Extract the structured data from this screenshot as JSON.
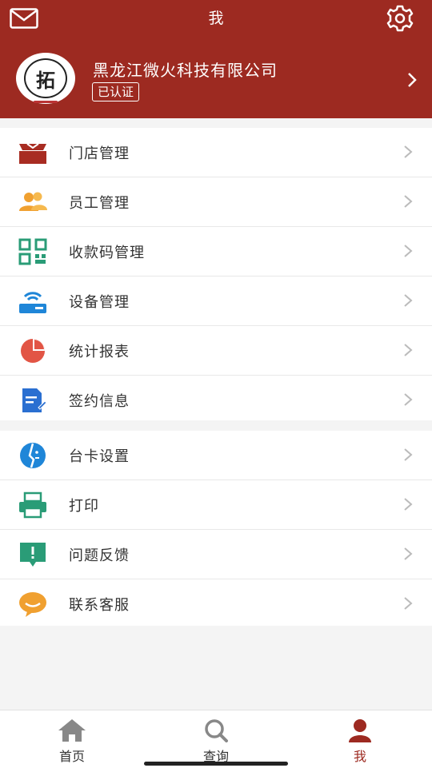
{
  "header": {
    "title": "我",
    "company_name": "黑龙江微火科技有限公司",
    "verified_label": "已认证",
    "avatar_glyph": "拓",
    "bg_color": "#9d2a21"
  },
  "menu_group_1": [
    {
      "label": "门店管理",
      "icon": "store-icon",
      "color": "#a82c22"
    },
    {
      "label": "员工管理",
      "icon": "staff-icon",
      "color": "#f0a030"
    },
    {
      "label": "收款码管理",
      "icon": "qr-code-icon",
      "color": "#2a9c77"
    },
    {
      "label": "设备管理",
      "icon": "router-icon",
      "color": "#1f86d8"
    },
    {
      "label": "统计报表",
      "icon": "pie-chart-icon",
      "color": "#e25545"
    },
    {
      "label": "签约信息",
      "icon": "document-icon",
      "color": "#2a6fd1"
    }
  ],
  "menu_group_2": [
    {
      "label": "台卡设置",
      "icon": "card-stand-icon",
      "color": "#1f86d8"
    },
    {
      "label": "打印",
      "icon": "printer-icon",
      "color": "#2a9c77"
    },
    {
      "label": "问题反馈",
      "icon": "feedback-icon",
      "color": "#2a9c77"
    },
    {
      "label": "联系客服",
      "icon": "chat-bubble-icon",
      "color": "#f0a030"
    }
  ],
  "tabbar": {
    "home_label": "首页",
    "search_label": "查询",
    "me_label": "我",
    "active_color": "#9d2a21",
    "inactive_color": "#888888"
  }
}
